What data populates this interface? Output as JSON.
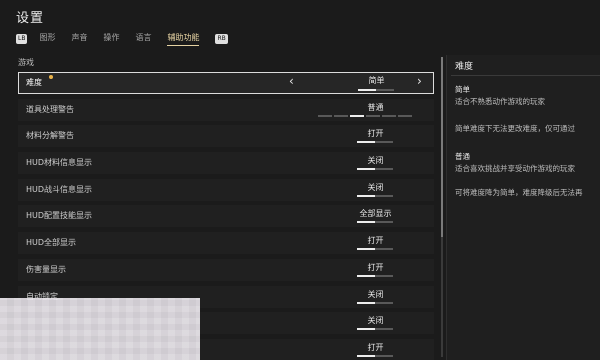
{
  "title": "设置",
  "tabs": {
    "left_key": "LB",
    "right_key": "RB",
    "items": [
      {
        "label": "图形",
        "active": false
      },
      {
        "label": "声音",
        "active": false
      },
      {
        "label": "操作",
        "active": false
      },
      {
        "label": "语言",
        "active": false
      },
      {
        "label": "辅助功能",
        "active": true
      }
    ]
  },
  "section": "游戏",
  "rows": [
    {
      "label": "难度",
      "value": "简单",
      "selected": true,
      "has_arrows": true,
      "has_dot": true,
      "bar_fill": 0.5
    },
    {
      "label": "道具处理警告",
      "value": "普通",
      "segments": 6,
      "segment_active": 2
    },
    {
      "label": "材料分解警告",
      "value": "打开",
      "bar_fill": 0.5
    },
    {
      "label": "HUD材料信息显示",
      "value": "关闭",
      "bar_fill": 0.5
    },
    {
      "label": "HUD战斗信息显示",
      "value": "关闭",
      "bar_fill": 0.5
    },
    {
      "label": "HUD配置技能显示",
      "value": "全部显示",
      "bar_fill": 0.5
    },
    {
      "label": "HUD全部显示",
      "value": "打开",
      "bar_fill": 0.5
    },
    {
      "label": "伤害量显示",
      "value": "打开",
      "bar_fill": 0.5
    },
    {
      "label": "自动锁定",
      "value": "关闭",
      "bar_fill": 0.5
    },
    {
      "label": "",
      "value": "关闭",
      "bar_fill": 0.5
    },
    {
      "label": "",
      "value": "打开",
      "bar_fill": 0.5
    }
  ],
  "panel": {
    "title": "难度",
    "lines": [
      {
        "text": "简单",
        "head": true
      },
      {
        "text": "适合不熟悉动作游戏的玩家",
        "head": false
      },
      {
        "text": "简单难度下无法更改难度，仅可通过",
        "head": false
      },
      {
        "text": "普通",
        "head": true
      },
      {
        "text": "适合喜欢挑战并享受动作游戏的玩家",
        "head": false
      },
      {
        "text": "可将难度降为简单，难度降级后无法再",
        "head": false
      }
    ]
  }
}
